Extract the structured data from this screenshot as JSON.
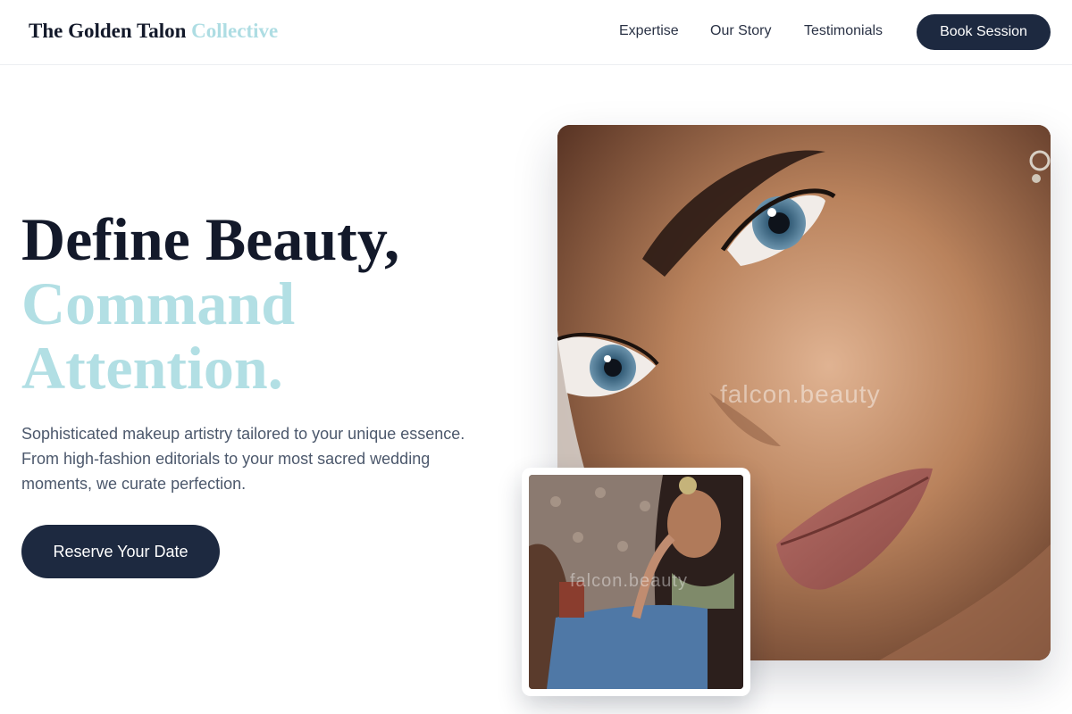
{
  "header": {
    "brand_main": "The Golden Talon",
    "brand_accent": "Collective",
    "nav": {
      "expertise": "Expertise",
      "our_story": "Our Story",
      "testimonials": "Testimonials"
    },
    "cta": "Book Session"
  },
  "hero": {
    "title_line1": "Define Beauty,",
    "title_line2": "Command",
    "title_line3": "Attention.",
    "subtitle": "Sophisticated makeup artistry tailored to your unique essence. From high-fashion editorials to your most sacred wedding moments, we curate perfection.",
    "cta": "Reserve Your Date"
  },
  "images": {
    "main_watermark": "falcon.beauty",
    "small_watermark": "falcon.beauty"
  },
  "colors": {
    "primary_dark": "#1d2940",
    "accent_light": "#b2dfe4",
    "text_muted": "#4c586c"
  }
}
